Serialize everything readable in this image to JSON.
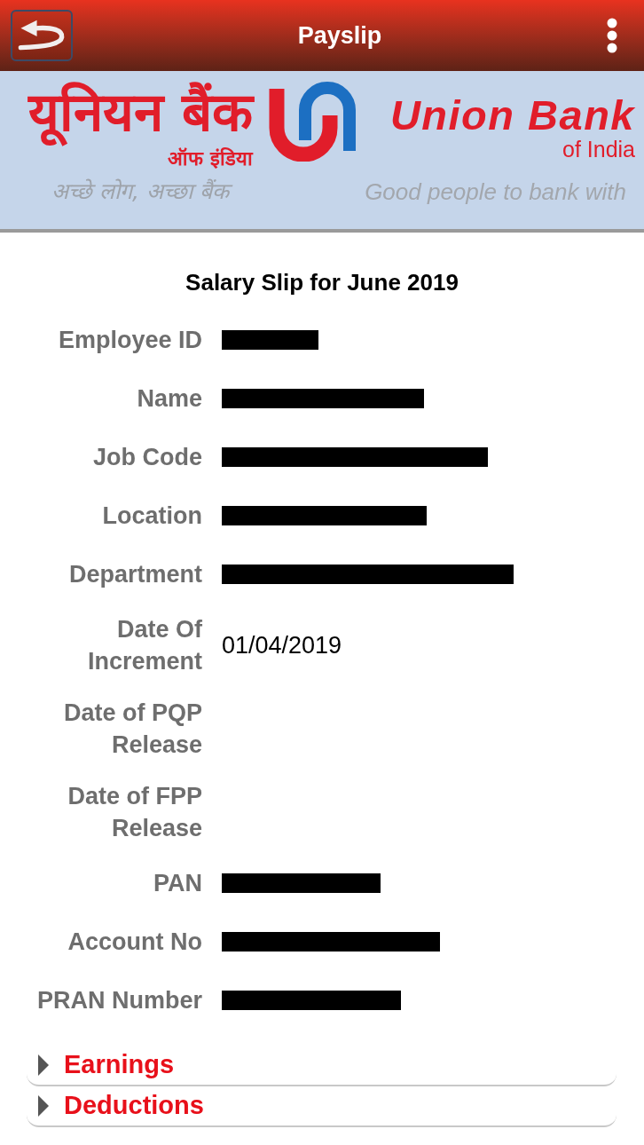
{
  "app_bar": {
    "title": "Payslip"
  },
  "banner": {
    "hindi_name": "यूनियन बैंक",
    "hindi_subtitle": "ऑफ इंडिया",
    "english_name": "Union Bank",
    "english_subtitle": "of India",
    "hindi_tagline": "अच्छे लोग, अच्छा बैंक",
    "english_tagline": "Good people to bank with"
  },
  "slip": {
    "title": "Salary Slip for June 2019",
    "fields": [
      {
        "label": "Employee ID",
        "redacted": true
      },
      {
        "label": "Name",
        "redacted": true
      },
      {
        "label": "Job Code",
        "redacted": true
      },
      {
        "label": "Location",
        "redacted": true
      },
      {
        "label": "Department",
        "redacted": true
      },
      {
        "label": "Date Of Increment",
        "value": "01/04/2019",
        "redacted": false
      },
      {
        "label": "Date of PQP Release",
        "redacted": false
      },
      {
        "label": "Date of FPP Release",
        "redacted": false
      },
      {
        "label": "PAN",
        "redacted": true
      },
      {
        "label": "Account No",
        "redacted": true
      },
      {
        "label": "PRAN Number",
        "redacted": true
      }
    ]
  },
  "sections": [
    {
      "label": "Earnings",
      "expanded": false
    },
    {
      "label": "Deductions",
      "expanded": false
    }
  ]
}
